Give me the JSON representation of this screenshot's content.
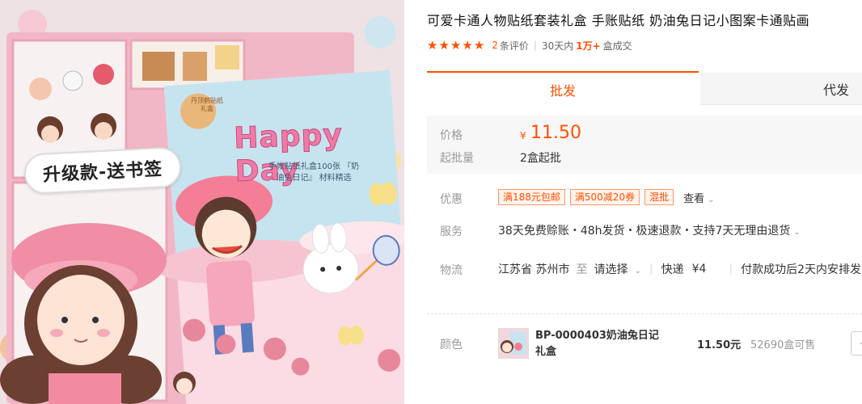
{
  "product": {
    "title": "可爱卡通人物贴纸套装礼盒 手账贴纸 奶油兔日记小图案卡通贴画",
    "image": {
      "sticker_tag": "升级款-送书签",
      "cover_title": "Happy Day",
      "cover_subtitle": "手帐贴纸礼盒100张 『奶油兔日记』 材料精选",
      "cover_badge": "丹顶鹤贴纸礼盒",
      "colors": {
        "box": "#f2b7c6",
        "cover_sky": "#bfe1ee",
        "cover_ground": "#f9d2dc",
        "brand_pink": "#f07aa6"
      }
    }
  },
  "rating": {
    "stars": 5,
    "review_count": "2",
    "review_suffix": "条评价",
    "period": "30天内",
    "sales": "1万+",
    "sales_suffix": "盒成交"
  },
  "tabs": {
    "wholesale": "批发",
    "dropship": "代发"
  },
  "price": {
    "label": "价格",
    "currency": "¥",
    "value": "11.50",
    "moq_label": "起批量",
    "moq_value": "2盒起批"
  },
  "promotions": {
    "label": "优惠",
    "coupons": [
      "满188元包邮",
      "满500减20券",
      "混批"
    ],
    "view": "查看"
  },
  "service": {
    "label": "服务",
    "text": "38天免费赊账・48h发货・极速退款・支持7天无理由退货"
  },
  "logistics": {
    "label": "物流",
    "origin": "江苏省 苏州市",
    "to": "至",
    "destination": "请选择",
    "carrier": "快递",
    "fee": "¥4",
    "note": "付款成功后2天内安排发货"
  },
  "sku": {
    "label": "颜色",
    "name": "BP-0000403奶油兔日记礼盒",
    "price": "11.50元",
    "stock": "52690盒可售",
    "minus": "-"
  },
  "accent_color": "#ff5000"
}
